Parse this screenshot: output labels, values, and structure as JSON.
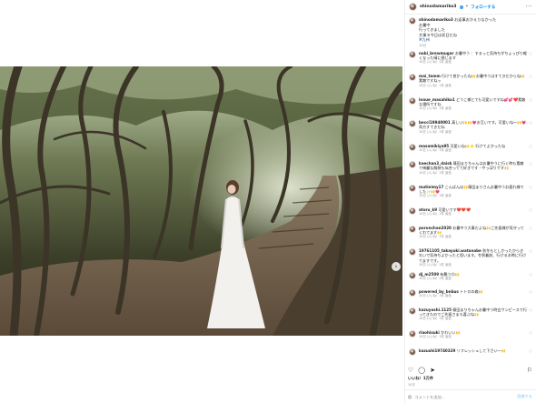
{
  "header": {
    "username": "shinodamariko3",
    "follow_label": "フォローする",
    "more_label": "···"
  },
  "caption": {
    "username": "shinodamariko3",
    "lines": [
      "お返事おかえりなかった",
      "お暑中",
      "行ってきました",
      "大事ラ今日は初日だね"
    ],
    "hashtag": "#九州",
    "meta": "10日"
  },
  "comments": [
    {
      "user": "nobi_brewmugar",
      "text": "お暑中う ：するっと気持ちがちょっぴり軽くなった晴に感じます",
      "meta": "10日   いいね！1件   返信"
    },
    {
      "user": "mai_tamm",
      "text": "行けて良かったね🙌お暑中うはすてきだからね🙌素敵ですねッ",
      "meta": "10日   いいね！1件   返信"
    },
    {
      "user": "inoue_masahiko1",
      "text": "どうこ様とても可愛いですね💕💕❤️素敵な場所ですね",
      "meta": "10日   いいね！1件   返信"
    },
    {
      "user": "becci19940001",
      "text": "真しい🙌🙌💗お互いです。可愛いね～🙌💗 両方すてきだね",
      "meta": "10日   いいね！1件   返信"
    },
    {
      "user": "masamikiya95",
      "text": "可愛いね🙌⭐️ 行けてよかったね",
      "meta": "10日   いいね！1件   返信"
    },
    {
      "user": "kaechan3_daisk",
      "text": "篠田まりちゃんはお暑中うに行く時も素敵で綺麗な服装も似合ってて好きです・やっぱりです🙌",
      "meta": "10日   いいね！1件   返信"
    },
    {
      "user": "mutieimy17",
      "text": "こんばんは🙌篠田まりさんお暑中うお疲れ様でした✨🙌💗",
      "meta": "10日   いいね！1件   返信"
    },
    {
      "user": "atoru_k9",
      "text": "可愛いです❤️❤️❤️",
      "meta": "10日   いいね！1件   返信"
    },
    {
      "user": "poronchan2020",
      "text": "お暑中う大事だよね🙌ご先祖様が見守ってくれてます🙌",
      "meta": "10日   いいね！1件   返信"
    },
    {
      "user": "19761105_takayuki.watanabe",
      "text": "秋冬もとしかったからきれいで気持ちよかったと思います。冬到着前、行けるお時に行けてますです。",
      "meta": "10日   いいね！1件   返信"
    },
    {
      "user": "dj_m2509",
      "text": "有難う😊🙌",
      "meta": "10日   いいね！1件   返信"
    },
    {
      "user": "powered_by_bnbus",
      "text": "トトロの森🙌",
      "meta": "10日   いいね！1件   返信"
    },
    {
      "user": "kazuyoshi.1125",
      "text": "篠田まりちゃんお暑中う時白ワンピースで行ってきたのでご先祖さまも喜ぶね🙌",
      "meta": "10日   いいね！1件   返信"
    },
    {
      "user": "riaohisuki",
      "text": "かわいい🙌",
      "meta": "10日   いいね！1件   返信"
    },
    {
      "user": "kazushi19740329",
      "text": "リフレッシュして下さい～🙌",
      "meta": ""
    }
  ],
  "actions": {
    "like_icon": "heart-icon",
    "comment_icon": "comment-icon",
    "share_icon": "share-icon",
    "save_icon": "bookmark-icon"
  },
  "likes": "いいね！1万件",
  "date": "10日",
  "comment_box": {
    "placeholder": "コメントを追加...",
    "post_label": "投稿する"
  }
}
